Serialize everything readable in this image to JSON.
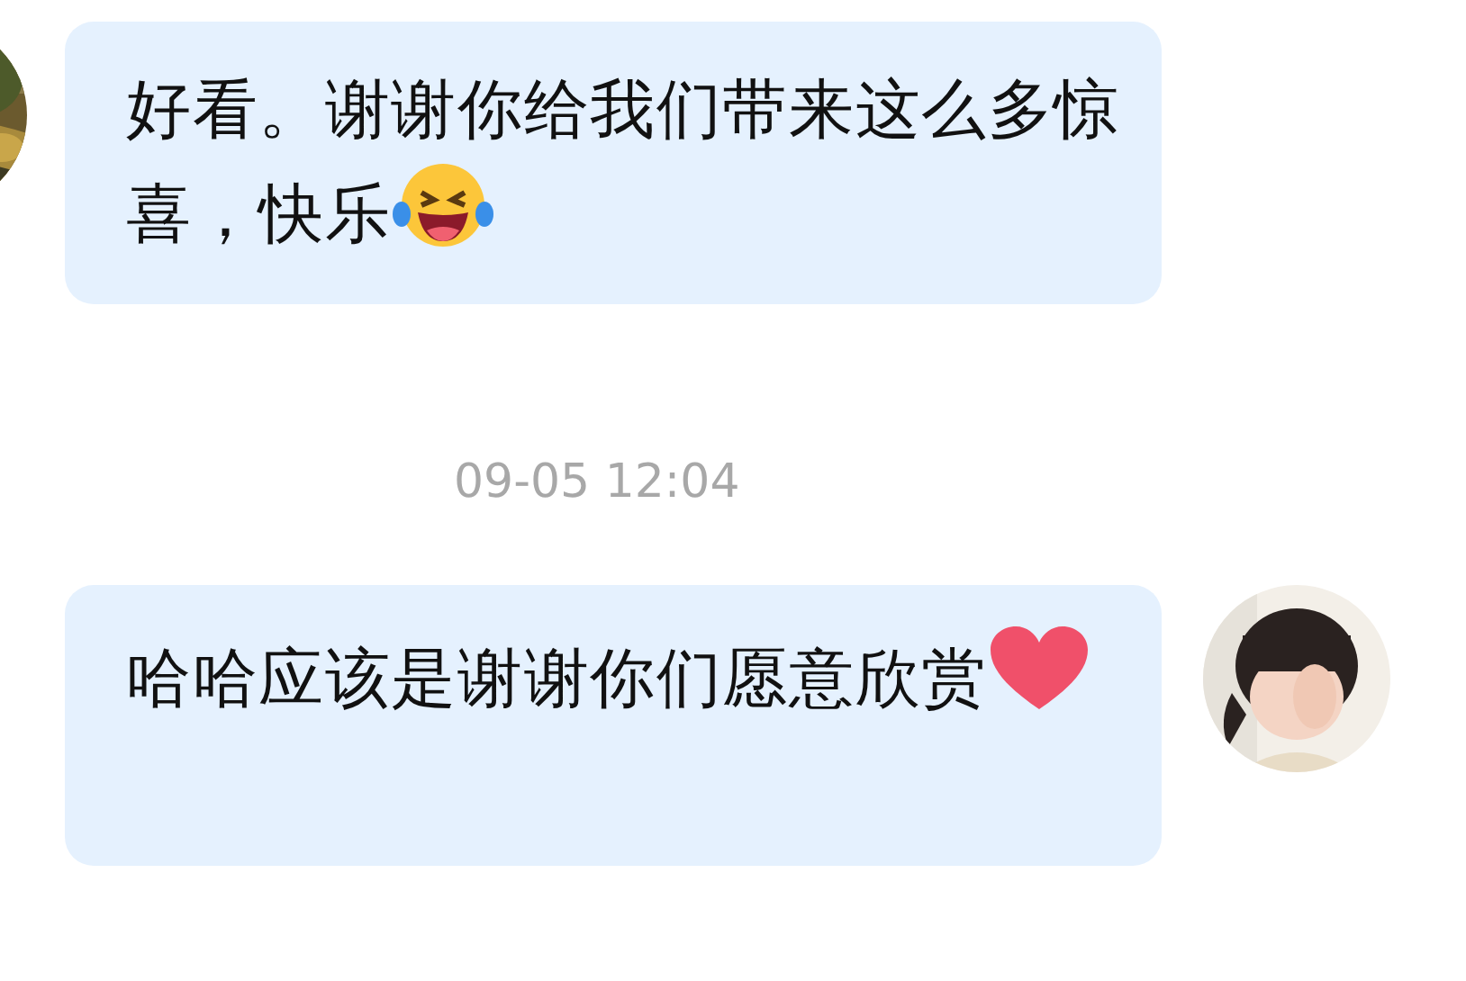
{
  "messages": [
    {
      "outgoing": false,
      "avatar": {
        "kind": "picture"
      },
      "parts": [
        {
          "kind": "text",
          "text": "好看。谢谢你给我们带来这么多惊喜，快乐"
        },
        {
          "kind": "laughing"
        }
      ]
    },
    {
      "kind": "timestamp",
      "text": "09-05 12:04"
    },
    {
      "outgoing": true,
      "avatar": {
        "kind": "picture"
      },
      "parts": [
        {
          "kind": "text",
          "text": "哈哈应该是谢谢你们愿意欣赏"
        },
        {
          "kind": "heart"
        }
      ]
    }
  ]
}
